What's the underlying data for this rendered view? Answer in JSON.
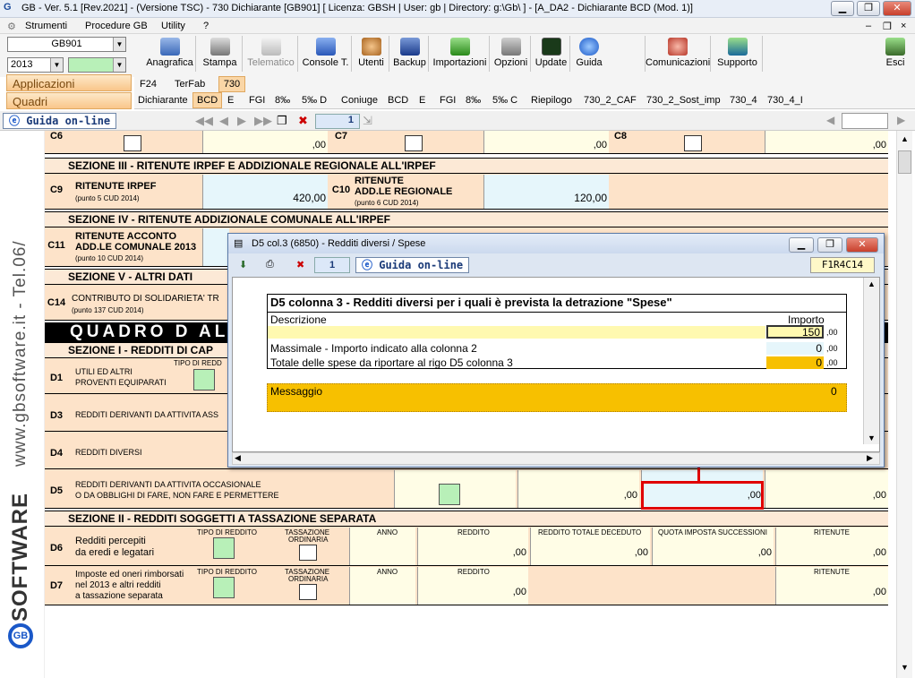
{
  "window": {
    "title": "GB - Ver. 5.1 [Rev.2021] - (Versione TSC) - 730 Dichiarante [GB901]    [ Licenza: GBSH | User: gb | Directory: g:\\Gb\\ ] - [A_DA2 - Dichiarante BCD (Mod. 1)]",
    "minimize": "▁",
    "restore": "❐",
    "close": "✕"
  },
  "menu": {
    "items": [
      "Strumenti",
      "Procedure GB",
      "Utility",
      "?"
    ],
    "right_controls": [
      "–",
      "❐",
      "×"
    ]
  },
  "toolbar": {
    "company": "GB901",
    "year": "2013",
    "buttons": [
      "Anagrafica",
      "Stampa",
      "Telematico",
      "Console T.",
      "Utenti",
      "Backup",
      "Importazioni",
      "Opzioni",
      "Update",
      "Guida",
      "Comunicazioni",
      "Supporto",
      "Esci"
    ]
  },
  "left_labels": {
    "applicazioni": "Applicazioni",
    "quadri": "Quadri"
  },
  "app_tabs": [
    "F24",
    "TerFab",
    "730"
  ],
  "quadri_tabs": [
    "Dichiarante",
    "BCD",
    "E",
    "FGI",
    "8‰",
    "5‰ D",
    "Coniuge",
    "BCD",
    "E",
    "FGI",
    "8‰",
    "5‰ C",
    "Riepilogo",
    "730_2_CAF",
    "730_2_Sost_imp",
    "730_4",
    "730_4_I"
  ],
  "nav": {
    "guida": "Guida on-line",
    "page": "1"
  },
  "sidebar": {
    "site": "www.gbsoftware.it - Tel.06/",
    "brand": "SOFTWARE",
    "brand_gb": "GB"
  },
  "form": {
    "c6": "C6",
    "c7": "C7",
    "c8": "C8",
    "zero": ",00",
    "sez3": "SEZIONE III  -  RITENUTE IRPEF E ADDIZIONALE REGIONALE ALL'IRPEF",
    "c9": {
      "code": "C9",
      "label": "RITENUTE IRPEF",
      "sub": "(punto 5 CUD 2014)",
      "value": "420,00"
    },
    "c10": {
      "code": "C10",
      "label1": "RITENUTE",
      "label2": "ADD.LE REGIONALE",
      "sub": "(punto 6 CUD 2014)",
      "value": "120,00"
    },
    "sez4": "SEZIONE IV  -  RITENUTE ADDIZIONALE COMUNALE ALL'IRPEF",
    "c11": {
      "code": "C11",
      "label1": "RITENUTE ACCONTO",
      "label2": "ADD.LE COMUNALE 2013",
      "sub": "(punto 10 CUD 2014)"
    },
    "sez5": "SEZIONE V  -  ALTRI DATI",
    "c14": {
      "code": "C14",
      "label": "CONTRIBUTO DI SOLIDARIETA' TR",
      "sub": "(punto 137 CUD 2014)"
    },
    "quadro": "QUADRO  D  ALT",
    "sezD1": "SEZIONE I  -  REDDITI DI CAP",
    "d1": {
      "code": "D1",
      "label1": "UTILI ED ALTRI",
      "label2": "PROVENTI EQUIPARATI",
      "tipo": "TIPO DI REDD"
    },
    "d3": {
      "code": "D3",
      "label": "REDDITI DERIVANTI DA ATTIVITA ASS"
    },
    "d4": {
      "code": "D4",
      "label": "REDDITI DIVERSI"
    },
    "d5": {
      "code": "D5",
      "label1": "REDDITI DERIVANTI DA ATTIVITA OCCASIONALE",
      "label2": "O DA OBBLIGHI DI FARE, NON FARE E PERMETTERE"
    },
    "sezD2": "SEZIONE II  -  REDDITI SOGGETTI A TASSAZIONE SEPARATA",
    "d6": {
      "code": "D6",
      "label1": "Redditi percepiti",
      "label2": "da eredi e legatari",
      "tipo": "TIPO DI REDDITO",
      "tass1": "TASSAZIONE",
      "tass2": "ORDINARIA",
      "anno": "ANNO",
      "reddito": "REDDITO",
      "deceduto": "REDDITO TOTALE DECEDUTO",
      "quota": "QUOTA IMPOSTA SUCCESSIONI",
      "ritenute": "RITENUTE"
    },
    "d7": {
      "code": "D7",
      "label1": "Imposte ed oneri rimborsati",
      "label2": "nel 2013 e altri redditi",
      "label3": "a tassazione separata",
      "tipo": "TIPO DI REDDITO",
      "tass1": "TASSAZIONE",
      "tass2": "ORDINARIA",
      "anno": "ANNO",
      "reddito": "REDDITO",
      "ritenute": "RITENUTE"
    }
  },
  "dialog": {
    "title": "D5 col.3 (6850) - Redditi diversi / Spese",
    "page": "1",
    "guida": "Guida on-line",
    "ref": "F1R4C14",
    "heading": "D5 colonna 3 - Redditi diversi per i quali è prevista la detrazione \"Spese\"",
    "col_desc": "Descrizione",
    "col_imp": "Importo",
    "row1_value": "150",
    "dec": ",00",
    "massimale_label": "Massimale - Importo indicato alla colonna 2",
    "massimale_value": "0",
    "totale_label": "Totale delle spese da riportare al rigo D5 colonna 3",
    "totale_value": "0",
    "messaggio_label": "Messaggio",
    "messaggio_value": "0"
  },
  "colors": {
    "accent_red": "#e00000",
    "form_bg": "#fde3c9",
    "yellow": "#fffde6",
    "orange": "#f7c000"
  }
}
